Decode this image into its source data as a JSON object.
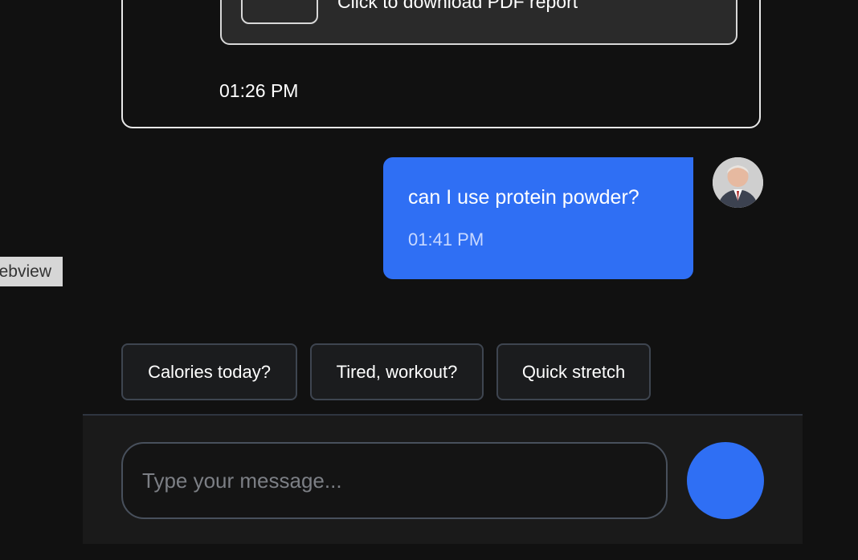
{
  "bot_message": {
    "attachment_text": "Click to download PDF report",
    "time": "01:26 PM"
  },
  "user_message": {
    "text": "can I use protein powder?",
    "time": "01:41 PM",
    "avatar_icon": "user-avatar"
  },
  "webview_tag": {
    "label": "ebview"
  },
  "quick_replies": [
    {
      "label": "Calories today?"
    },
    {
      "label": "Tired, workout?"
    },
    {
      "label": "Quick stretch"
    }
  ],
  "composer": {
    "placeholder": "Type your message...",
    "value": "",
    "send_icon": "send-icon"
  },
  "colors": {
    "background": "#111111",
    "accent": "#2f6ff4",
    "chip_border": "#3e4550"
  }
}
